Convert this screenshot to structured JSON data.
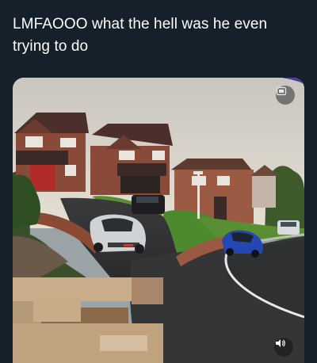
{
  "post": {
    "caption": "LMFAOOO what the hell was he even trying to do"
  },
  "media": {
    "kind": "video",
    "icons": {
      "gif_badge": "gif-icon",
      "sound": "speaker-icon"
    }
  }
}
